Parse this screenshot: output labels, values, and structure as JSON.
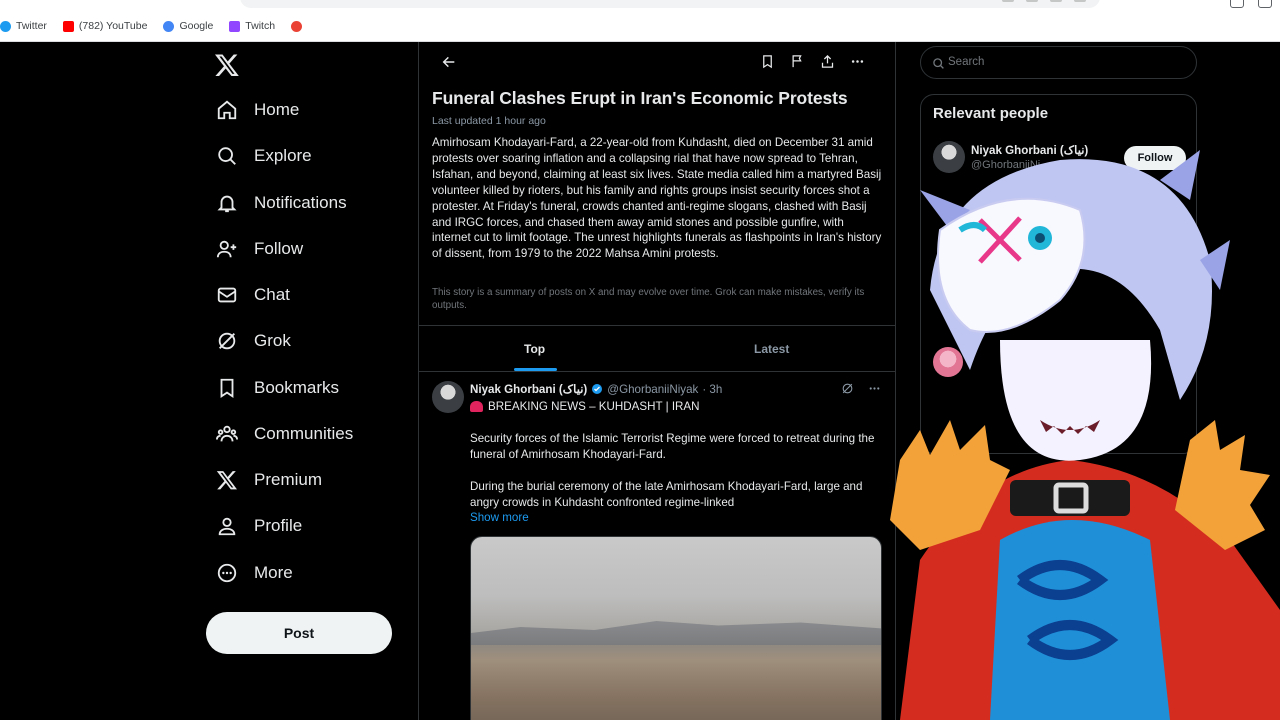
{
  "browser": {
    "bookmarks": [
      {
        "label": "Twitter",
        "color": "#1d9bf0"
      },
      {
        "label": "(782) YouTube",
        "color": "#ff0000"
      },
      {
        "label": "Google",
        "color": "#4285f4"
      },
      {
        "label": "Twitch",
        "color": "#9146ff"
      },
      {
        "label": "",
        "color": "#4285f4"
      }
    ]
  },
  "nav": {
    "items": [
      {
        "label": "Home",
        "icon": "home-icon"
      },
      {
        "label": "Explore",
        "icon": "search-icon"
      },
      {
        "label": "Notifications",
        "icon": "bell-icon"
      },
      {
        "label": "Follow",
        "icon": "person-plus-icon"
      },
      {
        "label": "Chat",
        "icon": "mail-icon"
      },
      {
        "label": "Grok",
        "icon": "grok-icon"
      },
      {
        "label": "Bookmarks",
        "icon": "bookmark-icon"
      },
      {
        "label": "Communities",
        "icon": "communities-icon"
      },
      {
        "label": "Premium",
        "icon": "x-icon"
      },
      {
        "label": "Profile",
        "icon": "profile-icon"
      },
      {
        "label": "More",
        "icon": "more-circle-icon"
      }
    ],
    "post_label": "Post"
  },
  "story": {
    "headline": "Funeral Clashes Erupt in Iran's Economic Protests",
    "updated": "Last updated 1 hour ago",
    "summary": "Amirhosam Khodayari-Fard, a 22-year-old from Kuhdasht, died on December 31 amid protests over soaring inflation and a collapsing rial that have now spread to Tehran, Isfahan, and beyond, claiming at least six lives. State media called him a martyred Basij volunteer killed by rioters, but his family and rights groups insist security forces shot a protester. At Friday's funeral, crowds chanted anti-regime slogans, clashed with Basij and IRGC forces, and chased them away amid stones and possible gunfire, with internet cut to limit footage. The unrest highlights funerals as flashpoints in Iran's history of dissent, from 1979 to the 2022 Mahsa Amini protests.",
    "disclaimer": "This story is a summary of posts on X and may evolve over time. Grok can make mistakes, verify its outputs."
  },
  "tabs": {
    "top": "Top",
    "latest": "Latest"
  },
  "tweet": {
    "name": "Niyak Ghorbani (نیاک)",
    "handle": "@GhorbaniiNiyak",
    "time": "· 3h",
    "line1": "BREAKING NEWS – KUHDASHT | IRAN",
    "body1": "Security forces of the Islamic Terrorist Regime were forced to retreat during the funeral of Amirhosam Khodayari-Fard.",
    "body2": "During the burial ceremony of the late Amirhosam Khodayari-Fard, large and angry crowds in Kuhdasht confronted regime-linked",
    "show_more": "Show more"
  },
  "right": {
    "search_placeholder": "Search",
    "relevant_title": "Relevant people",
    "person_name": "Niyak Ghorbani (نیاک)",
    "person_handle": "@GhorbaniiNi",
    "follow_label": "Follow"
  },
  "colors": {
    "accent": "#1d9bf0",
    "background": "#000000"
  }
}
